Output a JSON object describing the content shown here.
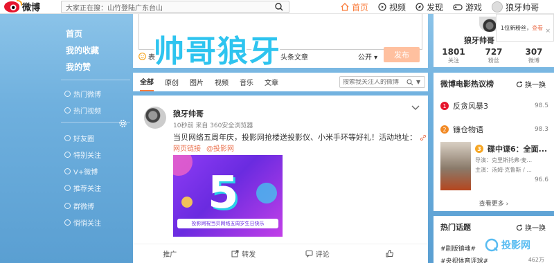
{
  "topbar": {
    "logo_text": "微博",
    "search_value": "大家正在搜：山竹登陆广东台山",
    "nav": [
      "首页",
      "视频",
      "发现",
      "游戏",
      "狼牙帅哥"
    ]
  },
  "leftnav": {
    "main": [
      "首页",
      "我的收藏",
      "我的赞"
    ],
    "secondary": [
      "热门微博",
      "热门视频"
    ],
    "groups": [
      "好友圈",
      "特别关注",
      "V+微博",
      "推荐关注",
      "群微博",
      "悄悄关注"
    ]
  },
  "composer": {
    "overlay_title": "帅哥狼牙",
    "tool_emoji": "表",
    "tool_more": "头条文章",
    "scope": "公开",
    "publish": "发布"
  },
  "feed_tabs": {
    "tabs": [
      "全部",
      "原创",
      "图片",
      "视频",
      "音乐",
      "文章"
    ],
    "search_placeholder": "搜索我关注人的微博"
  },
  "post": {
    "name": "狼牙帅哥",
    "meta": "10秒前 来自 360安全浏览器",
    "text": "当贝网络五周年庆，投影网抢楼送投影仪、小米手环等好礼！活动地址：",
    "link1": "网页链接",
    "link2": "@投影网",
    "image_number": "5",
    "image_banner": "投影网祝当贝网络五周岁生日快乐",
    "actions": [
      "推广",
      "转发",
      "评论",
      ""
    ]
  },
  "profile": {
    "name": "狼牙帅哥",
    "stats": [
      {
        "num": "1801",
        "label": "关注"
      },
      {
        "num": "727",
        "label": "粉丝"
      },
      {
        "num": "307",
        "label": "微博"
      }
    ],
    "notice_prefix": "1位新粉丝，",
    "notice_link": "查看",
    "notice_close": "×"
  },
  "movies": {
    "title": "微博电影热议榜",
    "refresh": "换一换",
    "items": [
      {
        "rank": "1",
        "name": "反贪风暴3",
        "score": "98.5",
        "color": "#e6162d"
      },
      {
        "rank": "2",
        "name": "镰仓物语",
        "score": "98.3",
        "color": "#f28a25"
      }
    ],
    "third": {
      "rank": "3",
      "name": "碟中谍6：全面...",
      "director": "导演：克里斯托弗·麦...",
      "cast": "主演：汤姆·克鲁斯 / ...",
      "score": "96.6"
    },
    "more": "查看更多 ›"
  },
  "hot": {
    "title": "热门话题",
    "refresh": "换一换",
    "items": [
      {
        "name": "#剧版镇魂#",
        "count": ""
      },
      {
        "name": "#央视体育评球#",
        "count": "462万"
      }
    ]
  },
  "watermark": "投影网"
}
